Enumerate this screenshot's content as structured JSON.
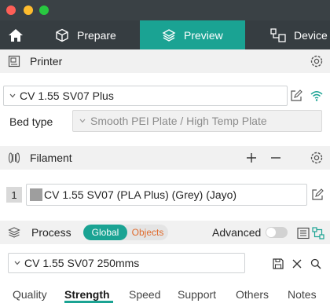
{
  "window": {
    "traffic_lights": [
      "close",
      "minimize",
      "zoom"
    ]
  },
  "tabs": {
    "home_icon": "home-icon",
    "prepare": "Prepare",
    "preview": "Preview",
    "device": "Device",
    "accent": "#1aa393"
  },
  "printer": {
    "title": "Printer",
    "selected": "CV 1.55 SV07 Plus",
    "bed_type_label": "Bed type",
    "bed_type_value": "Smooth PEI Plate / High Temp Plate"
  },
  "filament": {
    "title": "Filament",
    "items": [
      {
        "index": "1",
        "name": "CV 1.55 SV07 (PLA Plus) (Grey) (Jayo)",
        "color": "#9e9e9e"
      }
    ]
  },
  "process": {
    "title": "Process",
    "mode_global": "Global",
    "mode_objects": "Objects",
    "advanced_label": "Advanced",
    "advanced_enabled": false,
    "selected": "CV 1.55 SV07 250mms"
  },
  "subtabs": {
    "items": [
      "Quality",
      "Strength",
      "Speed",
      "Support",
      "Others",
      "Notes"
    ],
    "active": "Strength"
  }
}
